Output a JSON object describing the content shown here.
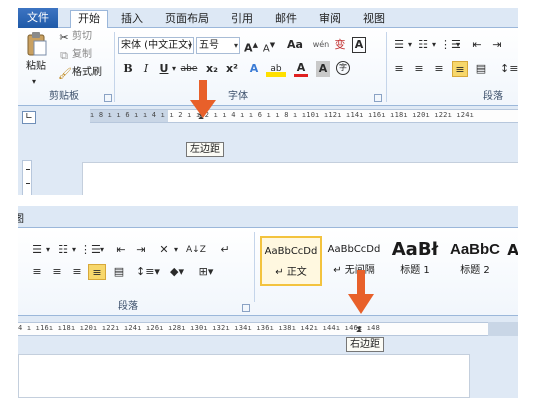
{
  "top_screenshot": {
    "tabs": [
      "文件",
      "开始",
      "插入",
      "页面布局",
      "引用",
      "邮件",
      "审阅",
      "视图"
    ],
    "clipboard": {
      "paste": "粘贴",
      "cut": "剪切",
      "copy": "复制",
      "format_painter": "格式刷",
      "group_label": "剪贴板"
    },
    "font": {
      "font_name": "宋体 (中文正文)",
      "font_size": "五号",
      "grow": "A",
      "shrink": "A",
      "case": "Aa",
      "phonetic": "wén",
      "enclose": "变",
      "border_char": "A",
      "bold": "B",
      "italic": "I",
      "underline": "U",
      "strike": "abe",
      "subscript": "x₂",
      "superscript": "x²",
      "text_effect": "A",
      "highlight": "ab",
      "font_color": "A",
      "shading": "A",
      "circle_char": "字",
      "group_label": "字体"
    },
    "paragraph": {
      "group_label": "段落"
    },
    "ruler_text": "ı 8 ı  ı 6 ı  ı 4 ı  ı 2 ı     ı 2 ı  ı 4 ı  ı 6 ı  ı 8 ı  ı10ı  ı12ı  ı14ı  ı16ı  ı18ı  ı20ı  ı22ı  ı24ı",
    "tooltip": "左边距"
  },
  "bottom_screenshot": {
    "title_fragment": "图",
    "paragraph": {
      "group_label": "段落"
    },
    "styles": [
      {
        "sample": "AaBbCcDd",
        "name": "↵ 正文"
      },
      {
        "sample": "AaBbCcDd",
        "name": "↵ 无间隔"
      },
      {
        "sample": "AaBł",
        "name": "标题 1"
      },
      {
        "sample": "AaBbC",
        "name": "标题 2"
      },
      {
        "sample": "A",
        "name": ""
      }
    ],
    "ruler_text": "4 ı  ı16ı  ı18ı  ı20ı  ı22ı  ı24ı  ı26ı  ı28ı  ı30ı  ı32ı  ı34ı  ı36ı  ı38ı     ı42ı  ı44ı  ı46ı  ı48",
    "tooltip": "右边距"
  },
  "colors": {
    "file_tab": "#2b579a",
    "highlight": "#f7d76b",
    "arrow": "#e8602a",
    "ribbon_border": "#9bb7da"
  }
}
